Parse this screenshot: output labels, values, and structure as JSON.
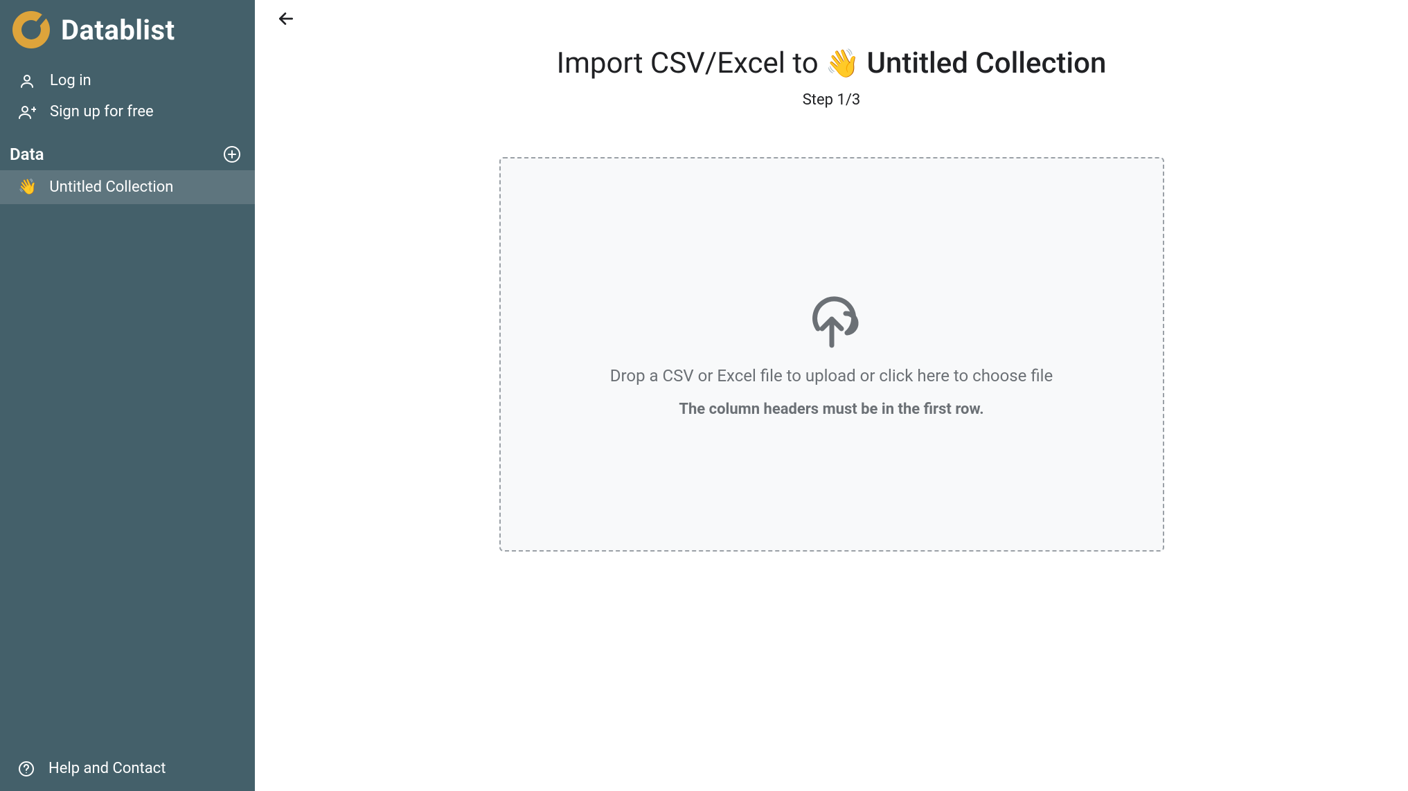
{
  "brand": {
    "name": "Datablist"
  },
  "sidebar": {
    "login": "Log in",
    "signup": "Sign up for free",
    "section_label": "Data",
    "items": [
      {
        "emoji": "👋",
        "label": "Untitled Collection"
      }
    ],
    "help": "Help and Contact"
  },
  "import": {
    "title_prefix": "Import CSV/Excel to",
    "collection_emoji": "👋",
    "collection_name": "Untitled Collection",
    "step_label": "Step 1/3",
    "drop_primary": "Drop a CSV or Excel file to upload or click here to choose file",
    "drop_secondary": "The column headers must be in the first row."
  }
}
